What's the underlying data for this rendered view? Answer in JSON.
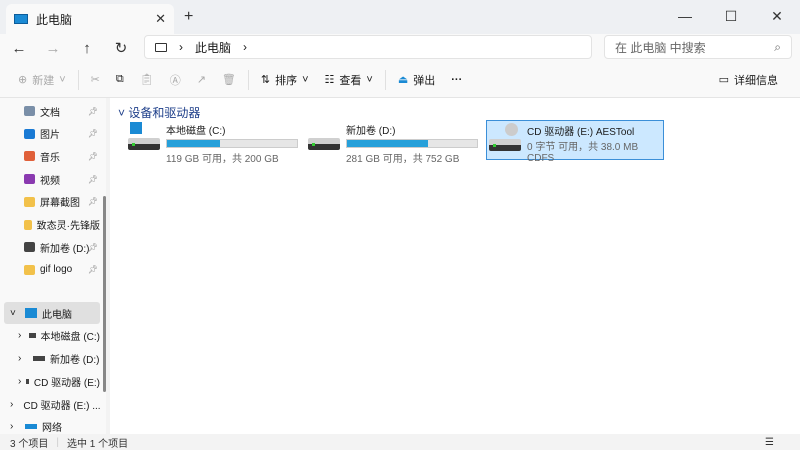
{
  "window": {
    "tab_title": "此电脑",
    "close_tab": "✕",
    "new_tab": "+",
    "minimize": "—",
    "maximize": "☐",
    "close": "✕"
  },
  "nav": {
    "back": "←",
    "forward": "→",
    "up": "↑",
    "refresh": "↻",
    "breadcrumb": "此电脑",
    "chev": "›",
    "chev2": "›",
    "search_placeholder": "在 此电脑 中搜索"
  },
  "toolbar": {
    "new": "新建",
    "sort": "排序",
    "view": "查看",
    "eject": "弹出",
    "more": "···",
    "details": "详细信息"
  },
  "sidebar": {
    "items": [
      {
        "label": "文档",
        "icon": "documents-icon",
        "pinned": true
      },
      {
        "label": "图片",
        "icon": "pictures-icon",
        "pinned": true
      },
      {
        "label": "音乐",
        "icon": "music-icon",
        "pinned": true
      },
      {
        "label": "视频",
        "icon": "videos-icon",
        "pinned": true
      },
      {
        "label": "屏幕截图",
        "icon": "folder-icon",
        "pinned": true
      },
      {
        "label": "致态灵·先锋版",
        "icon": "folder-icon",
        "pinned": true
      },
      {
        "label": "新加卷 (D:)",
        "icon": "drive-icon",
        "pinned": true
      },
      {
        "label": "gif logo",
        "icon": "folder-icon",
        "pinned": true
      }
    ],
    "tree": [
      {
        "label": "此电脑",
        "expanded": true
      },
      {
        "label": "本地磁盘 (C:)"
      },
      {
        "label": "新加卷 (D:)"
      },
      {
        "label": "CD 驱动器 (E:)"
      },
      {
        "label": "CD 驱动器 (E:) ..."
      },
      {
        "label": "网络"
      }
    ]
  },
  "main": {
    "group": "设备和驱动器",
    "drives": [
      {
        "name": "本地磁盘 (C:)",
        "free": "119 GB 可用，共 200 GB",
        "used_fraction": 0.405
      },
      {
        "name": "新加卷 (D:)",
        "free": "281 GB 可用，共 752 GB",
        "used_fraction": 0.626
      },
      {
        "name": "CD 驱动器 (E:) AESTool",
        "free": "0 字节 可用，共 38.0 MB",
        "fs": "CDFS",
        "selected": true
      }
    ]
  },
  "status": {
    "count": "3 个项目",
    "selected": "选中 1 个项目"
  },
  "colors": {
    "accent": "#26a0da",
    "selection": "#cce8ff"
  }
}
